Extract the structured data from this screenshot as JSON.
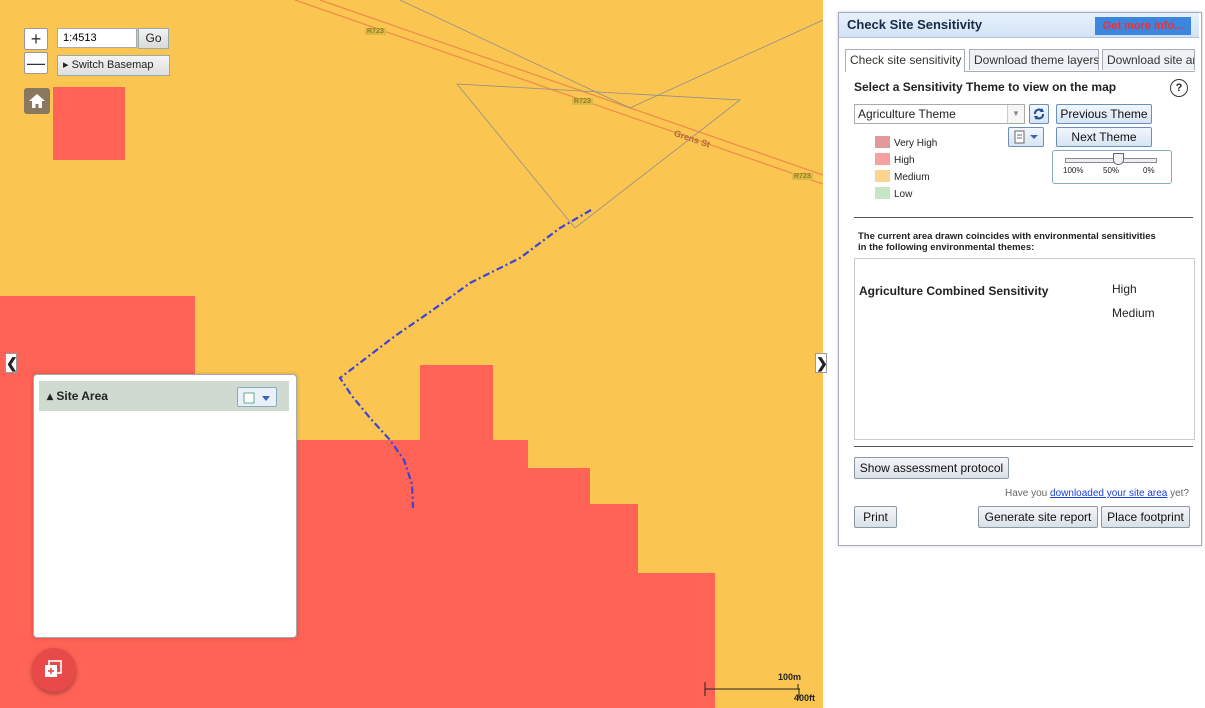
{
  "map": {
    "scale_value": "1:4513",
    "go_label": "Go",
    "zoom_in_label": "+",
    "zoom_out_label": "—",
    "switch_basemap_label": "▸ Switch Basemap",
    "road_labels": [
      "Grens St",
      "R723",
      "R723",
      "R723"
    ],
    "collapse_left_label": "❮",
    "collapse_right_label": "❯",
    "colors": {
      "medium_area": "#fbc552",
      "high_area": "#ff6356",
      "drawn_line": "#3a44d8",
      "road": "#f08a4a"
    }
  },
  "site_area_panel": {
    "title": "▴ Site Area"
  },
  "scalebar": {
    "metric_label": "100m",
    "imperial_label": "400ft"
  },
  "panel": {
    "title": "Check Site Sensitivity",
    "more_info_label": "Get more info...",
    "tabs": [
      {
        "label": "Check site sensitivity",
        "active": true
      },
      {
        "label": "Download theme layers",
        "active": false
      },
      {
        "label": "Download site area",
        "active": false
      }
    ],
    "select_heading": "Select a Sensitivity Theme to view on the map",
    "help_icon_label": "?",
    "theme_selected": "Agriculture Theme",
    "previous_theme_label": "Previous Theme",
    "next_theme_label": "Next Theme",
    "legend": [
      {
        "label": "Very High",
        "color": "#e09a9a"
      },
      {
        "label": "High",
        "color": "#f6a0a0"
      },
      {
        "label": "Medium",
        "color": "#fbd58c"
      },
      {
        "label": "Low",
        "color": "#c6e6c6"
      }
    ],
    "slider": {
      "ticks": [
        "100%",
        "50%",
        "0%"
      ],
      "value_percent": 50
    },
    "coincides_text_line1": "The current area drawn coincides with environmental sensitivities",
    "coincides_text_line2": "in the following environmental themes:",
    "results": [
      {
        "theme": "Agriculture Combined Sensitivity",
        "values": [
          "High",
          "Medium"
        ]
      }
    ],
    "show_protocol_label": "Show assessment protocol",
    "download_prompt_before": "Have you ",
    "download_prompt_link": "downloaded your site area",
    "download_prompt_after": " yet?",
    "print_label": "Print",
    "generate_report_label": "Generate site report",
    "place_footprint_label": "Place footprint"
  }
}
